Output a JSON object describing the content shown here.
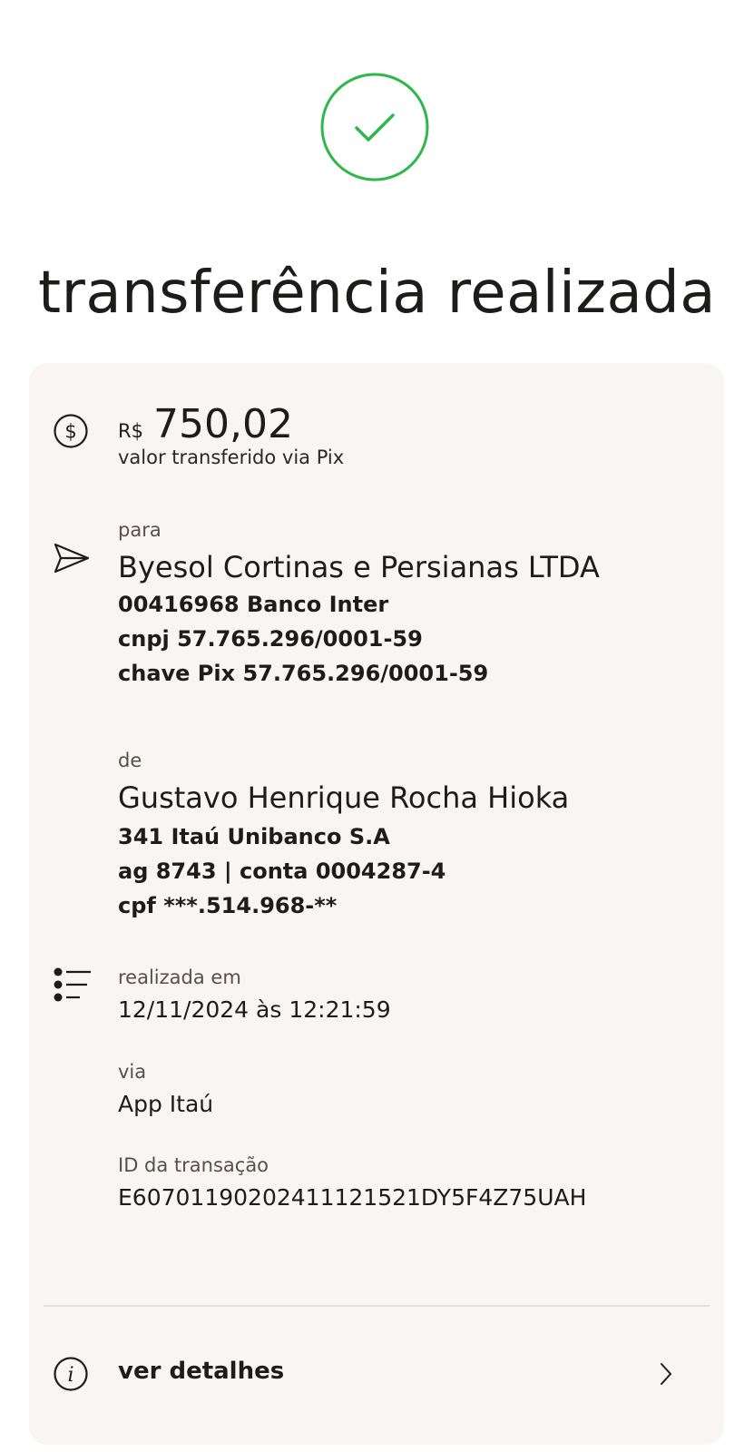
{
  "header": {
    "title": "transferência realizada",
    "success_icon": "check-circle-icon",
    "success_color": "#2fb84a"
  },
  "amount": {
    "currency": "R$",
    "value": "750,02",
    "caption": "valor transferido via Pix",
    "icon": "dollar-circle-icon"
  },
  "recipient": {
    "label": "para",
    "name": "Byesol Cortinas e Persianas LTDA",
    "bank": "00416968 Banco Inter",
    "document": "cnpj 57.765.296/0001-59",
    "pix_key": "chave Pix 57.765.296/0001-59",
    "icon": "send-icon"
  },
  "sender": {
    "label": "de",
    "name": "Gustavo Henrique Rocha Hioka",
    "bank": "341 Itaú Unibanco S.A",
    "account": "ag 8743 | conta 0004287-4",
    "document": "cpf ***.514.968-**"
  },
  "info": {
    "icon": "list-icon",
    "date_label": "realizada em",
    "date_value": "12/11/2024 às 12:21:59",
    "channel_label": "via",
    "channel_value": "App Itaú",
    "id_label": "ID da transação",
    "id_value": "E60701190202411121521DY5F4Z75UAH"
  },
  "details": {
    "label": "ver detalhes",
    "icon": "info-circle-icon",
    "chevron": "chevron-right-icon"
  },
  "colors": {
    "card_background": "#f8f5f3",
    "text": "#1e1c1a",
    "muted": "#55504c"
  }
}
